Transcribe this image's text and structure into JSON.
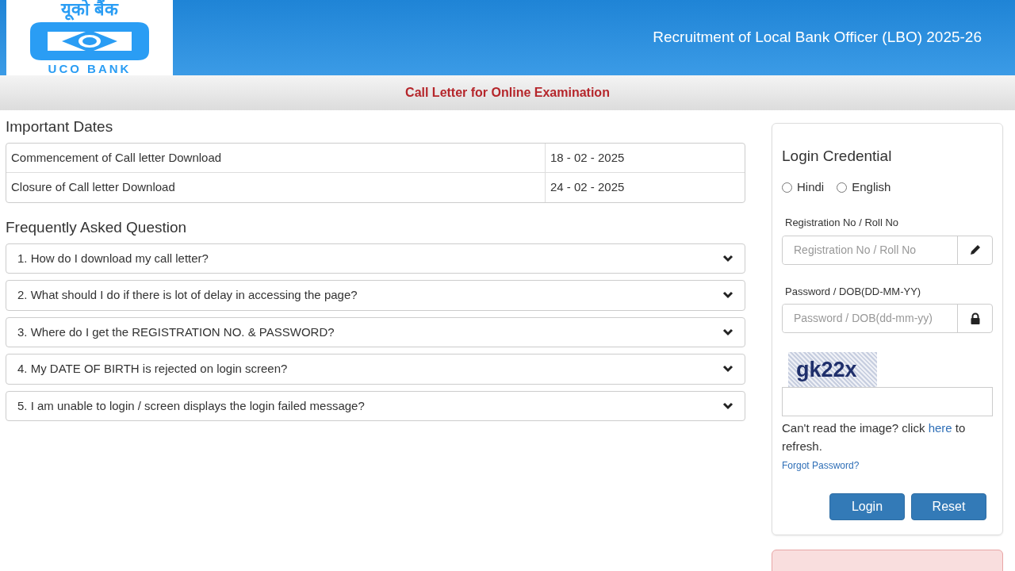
{
  "header": {
    "logo": {
      "hindi_name": "यूको बैंक",
      "english_name": "UCO BANK"
    },
    "title": "Recruitment of Local Bank Officer (LBO) 2025-26"
  },
  "subheader": {
    "title": "Call Letter for Online Examination"
  },
  "important_dates": {
    "heading": "Important Dates",
    "rows": [
      {
        "label": "Commencement of Call letter Download",
        "date": "18 - 02 - 2025"
      },
      {
        "label": "Closure of Call letter Download",
        "date": "24 - 02 - 2025"
      }
    ]
  },
  "faq": {
    "heading": "Frequently Asked Question",
    "items": [
      {
        "question": "1. How do I download my call letter?",
        "expanded": false
      },
      {
        "question": "2. What should I do if there is lot of delay in accessing the page?",
        "expanded": false
      },
      {
        "question": "3. Where do I get the REGISTRATION NO. & PASSWORD?",
        "expanded": false
      },
      {
        "question": "4. My DATE OF BIRTH is rejected on login screen?",
        "expanded": false
      },
      {
        "question": "5. I am unable to login / screen displays the login failed message?",
        "expanded": false
      }
    ]
  },
  "login": {
    "heading": "Login Credential",
    "languages": [
      {
        "label": "Hindi",
        "selected": false
      },
      {
        "label": "English",
        "selected": false
      }
    ],
    "fields": [
      {
        "label": "Registration No / Roll No",
        "placeholder": "Registration No / Roll No",
        "kind": "text"
      },
      {
        "label": "Password / DOB(DD-MM-YY)",
        "placeholder": "Password / DOB(dd-mm-yy)",
        "kind": "password"
      }
    ],
    "captcha": {
      "text": "gk22x"
    },
    "captcha_help": {
      "before": "Can't read the image? click ",
      "link": "here",
      "after": " to refresh."
    },
    "forgot_link": "Forgot Password?",
    "buttons": [
      "Login",
      "Reset"
    ]
  }
}
